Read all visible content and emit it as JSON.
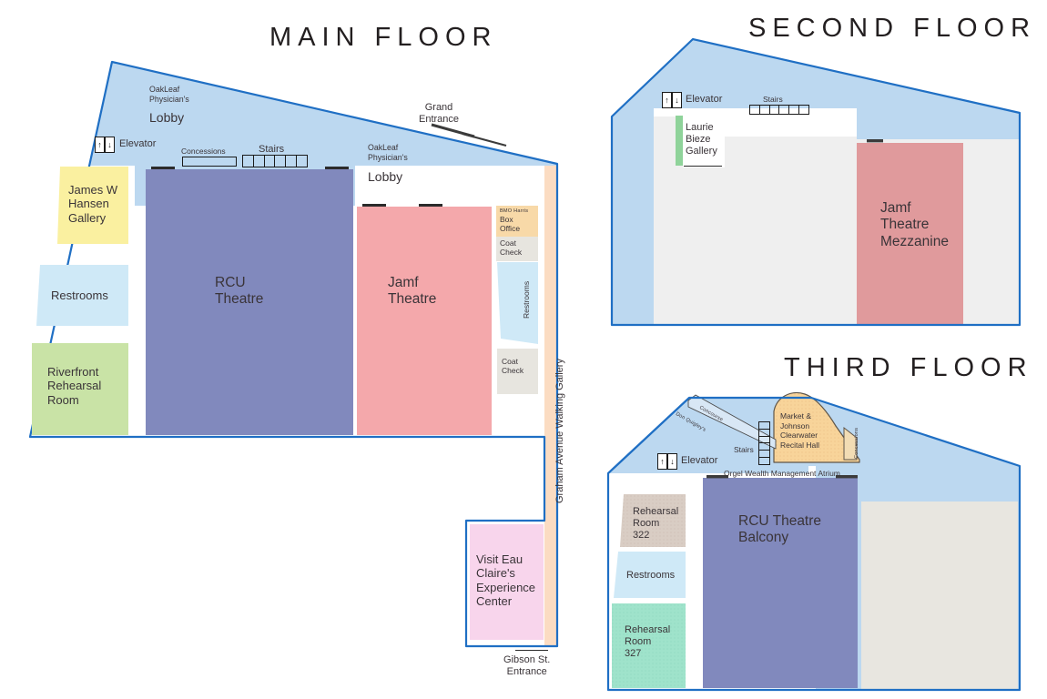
{
  "page": {
    "kind": "building-floor-plan",
    "venue_colors": {
      "outline_blue": "#1f6fc4",
      "lobby_blue": "#bcd8f0",
      "rcu_purple": "#8189bd",
      "jamf_pink": "#f4a8ab",
      "mezzanine_rose": "#e09a9c",
      "yellow_gallery": "#faf0a0",
      "light_blue_restroom": "#cfe9f7",
      "green_rehearsal": "#c9e3a6",
      "pink_experience": "#f8d5ec",
      "peach_gallery": "#fbdcc2",
      "box_office_tan": "#f8d9a8",
      "coat_check_grey": "#e7e5df",
      "recital_gold": "#f8d49a",
      "grey_fill": "#efefef",
      "warm_grey_fill": "#e8e6e0",
      "taupe_rehearsal": "#d9cdc4",
      "mint_rehearsal": "#9fe3cb",
      "green_strip": "#8fd39a"
    },
    "floors": [
      {
        "id": "main",
        "title": "MAIN FLOOR",
        "rooms": [
          {
            "name": "lobby-upper",
            "label": "OakLeaf\nPhysician's",
            "label2": "Lobby"
          },
          {
            "name": "lobby-right",
            "label": "OakLeaf\nPhysician's",
            "label2": "Lobby"
          },
          {
            "name": "james-w-hansen-gallery",
            "label": "James W\nHansen\nGallery"
          },
          {
            "name": "restrooms",
            "label": "Restrooms"
          },
          {
            "name": "riverfront-rehearsal-room",
            "label": "Riverfront\nRehearsal\nRoom"
          },
          {
            "name": "rcu-theatre",
            "label": "RCU\nTheatre"
          },
          {
            "name": "jamf-theatre",
            "label": "Jamf\nTheatre"
          },
          {
            "name": "box-office",
            "label": "BMO Harris",
            "label2": "Box\nOffice"
          },
          {
            "name": "coat-check-upper",
            "label": "Coat\nCheck"
          },
          {
            "name": "restrooms-right",
            "label": "Restrooms"
          },
          {
            "name": "coat-check-lower",
            "label": "Coat\nCheck"
          },
          {
            "name": "graham-avenue-walking-gallery",
            "label": "Graham Avenue Walking Gallery"
          },
          {
            "name": "visit-eau-claire-experience-center",
            "label": "Visit Eau\nClaire's\nExperience\nCenter"
          }
        ],
        "annotations": [
          {
            "name": "elevator",
            "label": "Elevator"
          },
          {
            "name": "concessions",
            "label": "Concessions"
          },
          {
            "name": "stairs",
            "label": "Stairs",
            "steps": 6
          },
          {
            "name": "grand-entrance",
            "label": "Grand\nEntrance"
          },
          {
            "name": "gibson-street-entrance",
            "label": "Gibson St.\nEntrance"
          }
        ]
      },
      {
        "id": "second",
        "title": "SECOND FLOOR",
        "rooms": [
          {
            "name": "laurie-bieze-gallery",
            "label": "Laurie\nBieze\nGallery"
          },
          {
            "name": "jamf-theatre-mezzanine",
            "label": "Jamf\nTheatre\nMezzanine"
          }
        ],
        "annotations": [
          {
            "name": "elevator",
            "label": "Elevator"
          },
          {
            "name": "stairs",
            "label": "Stairs",
            "steps": 6
          }
        ]
      },
      {
        "id": "third",
        "title": "THIRD FLOOR",
        "rooms": [
          {
            "name": "rehearsal-room-322",
            "label": "Rehearsal\nRoom\n322"
          },
          {
            "name": "restrooms",
            "label": "Restrooms"
          },
          {
            "name": "rehearsal-room-327",
            "label": "Rehearsal\nRoom\n327"
          },
          {
            "name": "rcu-theatre-balcony",
            "label": "RCU Theatre\nBalcony"
          },
          {
            "name": "market-johnson-clearwater-recital-hall",
            "label": "Market &\nJohnson\nClearwater\nRecital Hall"
          }
        ],
        "annotations": [
          {
            "name": "elevator",
            "label": "Elevator"
          },
          {
            "name": "stairs",
            "label": "Stairs",
            "steps": 6
          },
          {
            "name": "don-quigleys-concourse-a",
            "label": "Don Quigley's"
          },
          {
            "name": "don-quigleys-concourse-b",
            "label": "Concourse"
          },
          {
            "name": "concessions-recital",
            "label": "Concessions"
          },
          {
            "name": "orgel-wealth-management-atrium",
            "label": "Orgel Wealth Management Atrium"
          }
        ]
      }
    ]
  }
}
